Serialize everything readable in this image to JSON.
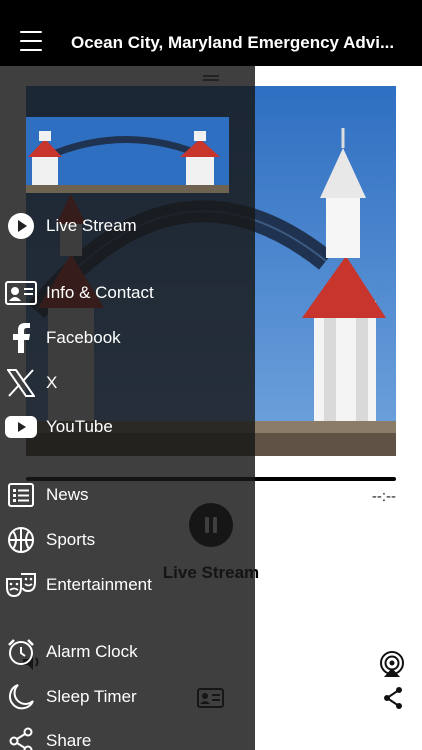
{
  "header": {
    "title": "Ocean City, Maryland Emergency Advi..."
  },
  "player": {
    "artwork_icon": "ocean-city-boardwalk-arch-artwork",
    "time_remaining": "--:--",
    "now_playing": "Live Stream",
    "progress": 0,
    "controls": [
      "pause-icon",
      "volume-icon",
      "airplay-icon",
      "contact-card-icon",
      "share-icon"
    ]
  },
  "drawer": {
    "banner_icon": "boardwalk-banner-image",
    "items": [
      {
        "label": "Live Stream",
        "icon": "play-circle-icon"
      },
      {
        "label": "Info & Contact",
        "icon": "contact-card-icon"
      },
      {
        "label": "Facebook",
        "icon": "facebook-icon"
      },
      {
        "label": "X",
        "icon": "x-logo-icon"
      },
      {
        "label": "YouTube",
        "icon": "youtube-icon"
      },
      {
        "label": "News",
        "icon": "news-list-icon"
      },
      {
        "label": "Sports",
        "icon": "basketball-icon"
      },
      {
        "label": "Entertainment",
        "icon": "theater-masks-icon"
      },
      {
        "label": "Alarm Clock",
        "icon": "alarm-clock-icon"
      },
      {
        "label": "Sleep Timer",
        "icon": "moon-icon"
      },
      {
        "label": "Share",
        "icon": "share-icon"
      }
    ]
  },
  "colors": {
    "header_bg": "#000000",
    "drawer_bg": "#181818",
    "sky": "#3a78c9",
    "arch_roof": "#c8352c"
  }
}
